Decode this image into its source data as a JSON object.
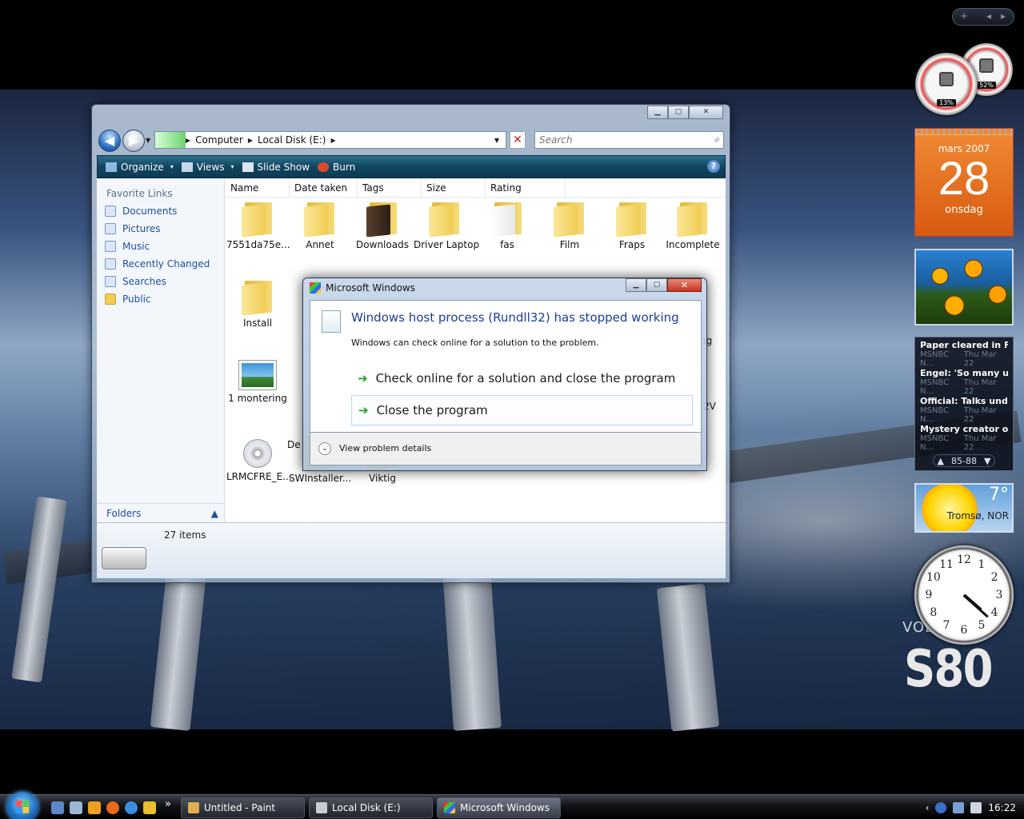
{
  "sidebar": {
    "add_label": "+",
    "prev_label": "◂",
    "next_label": "▸",
    "gauges": [
      {
        "percent": "13%"
      },
      {
        "percent": "52%"
      }
    ],
    "calendar": {
      "month": "mars 2007",
      "day": "28",
      "weekday": "onsdag"
    },
    "news": [
      {
        "headline": "Paper cleared in Fren...",
        "source": "MSNBC N...",
        "date": "Thu Mar 22"
      },
      {
        "headline": "Engel: 'So many ugly...",
        "source": "MSNBC N...",
        "date": "Thu Mar 22"
      },
      {
        "headline": "Official: Talks under ...",
        "source": "MSNBC N...",
        "date": "Thu Mar 22"
      },
      {
        "headline": "Mystery creator of a...",
        "source": "MSNBC N...",
        "date": "Thu Mar 22"
      }
    ],
    "news_nav": {
      "up": "▲",
      "range": "85-88",
      "down": "▼"
    },
    "weather": {
      "temp": "7°",
      "city": "Tromsø, NOR"
    },
    "clock": {
      "time": "16:22",
      "numbers": [
        "12",
        "1",
        "2",
        "3",
        "4",
        "5",
        "6",
        "7",
        "8",
        "9",
        "10",
        "11"
      ]
    }
  },
  "wallpaper": {
    "brand_small": "VOL",
    "brand_big": "S80"
  },
  "explorer": {
    "caption": {
      "minimize": "▁",
      "maximize": "▢",
      "close": "✕"
    },
    "breadcrumb": [
      "Computer",
      "Local Disk (E:)"
    ],
    "search_placeholder": "Search",
    "toolbar": [
      {
        "label": "Organize",
        "caret": "▾",
        "icon_color": "#8fb8e0"
      },
      {
        "label": "Views",
        "caret": "▾",
        "icon_color": "#c7d7ea"
      },
      {
        "label": "Slide Show",
        "caret": "",
        "icon_color": "#dfe7f2"
      },
      {
        "label": "Burn",
        "caret": "",
        "icon_color": "#e04a2a"
      }
    ],
    "help_label": "?",
    "favorite_links_title": "Favorite Links",
    "favorite_links": [
      "Documents",
      "Pictures",
      "Music",
      "Recently Changed",
      "Searches",
      "Public"
    ],
    "folders_label": "Folders",
    "folders_chevron": "▲",
    "columns": [
      "Name",
      "Date taken",
      "Tags",
      "Size",
      "Rating"
    ],
    "files": [
      {
        "name": "7551da75e...",
        "kind": "folder"
      },
      {
        "name": "Annet",
        "kind": "folder"
      },
      {
        "name": "Downloads",
        "kind": "folder"
      },
      {
        "name": "Driver Laptop",
        "kind": "folder"
      },
      {
        "name": "fas",
        "kind": "folder"
      },
      {
        "name": "Film",
        "kind": "folder"
      },
      {
        "name": "Fraps",
        "kind": "folder"
      },
      {
        "name": "Incomplete",
        "kind": "folder"
      },
      {
        "name": "Install",
        "kind": "folder"
      },
      {
        "name": "1 montering",
        "kind": "image"
      },
      {
        "name": "LRMCFRE_E...",
        "kind": "disc"
      },
      {
        "name": "SWInstaller...",
        "kind": "folder"
      },
      {
        "name": "Viktig",
        "kind": "folder"
      }
    ],
    "partial_labels": [
      "De",
      "ng",
      "2V"
    ],
    "item_count": "27 items"
  },
  "dialog": {
    "title": "Microsoft Windows",
    "headline": "Windows host process (Rundll32) has stopped working",
    "subtext": "Windows can check online for a solution to the problem.",
    "option_check": "Check online for a solution and close the program",
    "option_close": "Close the program",
    "details_label": "View problem details",
    "arrow": "➔",
    "chevron": "⌄"
  },
  "taskbar": {
    "more": "»",
    "tasks": [
      "Untitled - Paint",
      "Local Disk (E:)",
      "Microsoft Windows"
    ],
    "tray_chevron": "‹",
    "time": "16:22"
  },
  "colors": {
    "accent": "#1a3d9a",
    "toolbar": "#11455f",
    "calendar": "#e0661a"
  }
}
